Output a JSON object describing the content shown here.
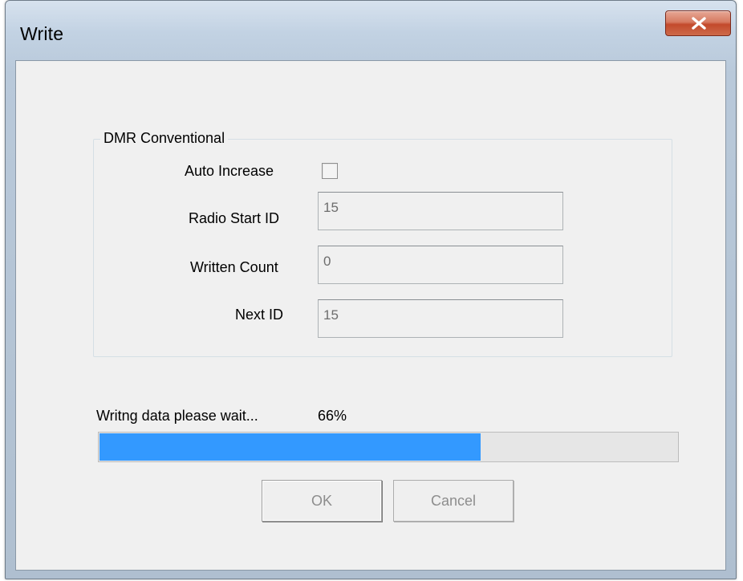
{
  "window": {
    "title": "Write",
    "close_icon": "close-x-icon"
  },
  "group": {
    "title": "DMR Conventional",
    "auto_increase_label": "Auto Increase",
    "auto_increase_checked": false,
    "radio_start_id_label": "Radio Start ID",
    "radio_start_id_value": "15",
    "written_count_label": "Written Count",
    "written_count_value": "0",
    "next_id_label": "Next ID",
    "next_id_value": "15"
  },
  "status": {
    "text": "Writng data please wait...",
    "percent_text": "66%",
    "progress_fraction": 0.66,
    "progress_color": "#3399ff"
  },
  "buttons": {
    "ok_label": "OK",
    "cancel_label": "Cancel"
  }
}
